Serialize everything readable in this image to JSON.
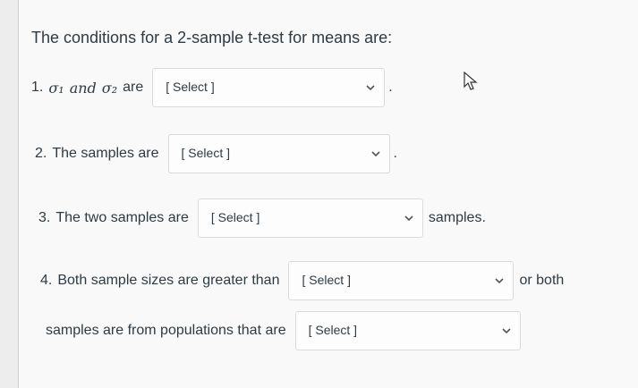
{
  "question": {
    "prompt": "The conditions for a 2-sample t-test for means are:"
  },
  "items": [
    {
      "number": "1.",
      "lead_text": "are",
      "select_placeholder": "[ Select ]",
      "trailing": "."
    },
    {
      "number": "2.",
      "lead_text": "The samples are",
      "select_placeholder": "[ Select ]",
      "trailing": "."
    },
    {
      "number": "3.",
      "lead_text": "The two samples are",
      "select_placeholder": "[ Select ]",
      "trailing": "samples."
    },
    {
      "number": "4.",
      "lead_text": "Both sample sizes are greater than",
      "select_placeholder": "[ Select ]",
      "trailing": "or both"
    },
    {
      "number": "",
      "lead_text": "samples are from populations that are",
      "select_placeholder": "[ Select ]",
      "trailing": ""
    }
  ],
  "math": {
    "sigma1": "σ₁",
    "and": "and",
    "sigma2": "σ₂"
  },
  "icons": {
    "chevron": "chevron-down-icon",
    "cursor": "mouse-cursor-icon"
  }
}
